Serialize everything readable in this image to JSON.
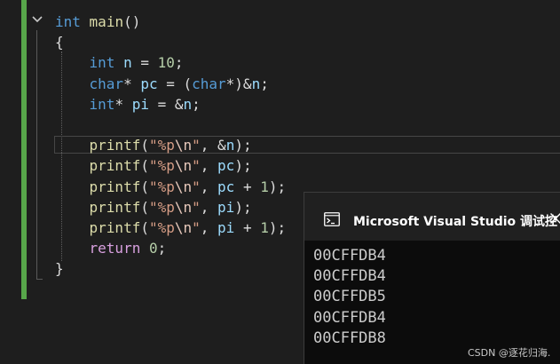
{
  "editor": {
    "lines": [
      [
        {
          "t": "int",
          "c": "kw"
        },
        {
          "t": " ",
          "c": "p"
        },
        {
          "t": "main",
          "c": "fn"
        },
        {
          "t": "()",
          "c": "p"
        }
      ],
      [
        {
          "t": "{",
          "c": "p"
        }
      ],
      [
        {
          "t": "    ",
          "c": "p"
        },
        {
          "t": "int",
          "c": "kw"
        },
        {
          "t": " ",
          "c": "p"
        },
        {
          "t": "n",
          "c": "id"
        },
        {
          "t": " = ",
          "c": "p"
        },
        {
          "t": "10",
          "c": "num"
        },
        {
          "t": ";",
          "c": "p"
        }
      ],
      [
        {
          "t": "    ",
          "c": "p"
        },
        {
          "t": "char",
          "c": "kw"
        },
        {
          "t": "* ",
          "c": "p"
        },
        {
          "t": "pc",
          "c": "id"
        },
        {
          "t": " = (",
          "c": "p"
        },
        {
          "t": "char",
          "c": "kw"
        },
        {
          "t": "*)&",
          "c": "p"
        },
        {
          "t": "n",
          "c": "id"
        },
        {
          "t": ";",
          "c": "p"
        }
      ],
      [
        {
          "t": "    ",
          "c": "p"
        },
        {
          "t": "int",
          "c": "kw"
        },
        {
          "t": "* ",
          "c": "p"
        },
        {
          "t": "pi",
          "c": "id"
        },
        {
          "t": " = &",
          "c": "p"
        },
        {
          "t": "n",
          "c": "id"
        },
        {
          "t": ";",
          "c": "p"
        }
      ],
      [
        {
          "t": "",
          "c": "p"
        }
      ],
      [
        {
          "t": "    ",
          "c": "p"
        },
        {
          "t": "printf",
          "c": "fn"
        },
        {
          "t": "(",
          "c": "p"
        },
        {
          "t": "\"%p",
          "c": "str"
        },
        {
          "t": "\\n",
          "c": "esc"
        },
        {
          "t": "\"",
          "c": "str"
        },
        {
          "t": ", &",
          "c": "p"
        },
        {
          "t": "n",
          "c": "id"
        },
        {
          "t": ");",
          "c": "p"
        }
      ],
      [
        {
          "t": "    ",
          "c": "p"
        },
        {
          "t": "printf",
          "c": "fn"
        },
        {
          "t": "(",
          "c": "p"
        },
        {
          "t": "\"%p",
          "c": "str"
        },
        {
          "t": "\\n",
          "c": "esc"
        },
        {
          "t": "\"",
          "c": "str"
        },
        {
          "t": ", ",
          "c": "p"
        },
        {
          "t": "pc",
          "c": "id"
        },
        {
          "t": ");",
          "c": "p"
        }
      ],
      [
        {
          "t": "    ",
          "c": "p"
        },
        {
          "t": "printf",
          "c": "fn"
        },
        {
          "t": "(",
          "c": "p"
        },
        {
          "t": "\"%p",
          "c": "str"
        },
        {
          "t": "\\n",
          "c": "esc"
        },
        {
          "t": "\"",
          "c": "str"
        },
        {
          "t": ", ",
          "c": "p"
        },
        {
          "t": "pc",
          "c": "id"
        },
        {
          "t": " + ",
          "c": "p"
        },
        {
          "t": "1",
          "c": "num"
        },
        {
          "t": ");",
          "c": "p"
        }
      ],
      [
        {
          "t": "    ",
          "c": "p"
        },
        {
          "t": "printf",
          "c": "fn"
        },
        {
          "t": "(",
          "c": "p"
        },
        {
          "t": "\"%p",
          "c": "str"
        },
        {
          "t": "\\n",
          "c": "esc"
        },
        {
          "t": "\"",
          "c": "str"
        },
        {
          "t": ", ",
          "c": "p"
        },
        {
          "t": "pi",
          "c": "id"
        },
        {
          "t": ");",
          "c": "p"
        }
      ],
      [
        {
          "t": "    ",
          "c": "p"
        },
        {
          "t": "printf",
          "c": "fn"
        },
        {
          "t": "(",
          "c": "p"
        },
        {
          "t": "\"%p",
          "c": "str"
        },
        {
          "t": "\\n",
          "c": "esc"
        },
        {
          "t": "\"",
          "c": "str"
        },
        {
          "t": ", ",
          "c": "p"
        },
        {
          "t": "pi",
          "c": "id"
        },
        {
          "t": " + ",
          "c": "p"
        },
        {
          "t": "1",
          "c": "num"
        },
        {
          "t": ");",
          "c": "p"
        }
      ],
      [
        {
          "t": "    ",
          "c": "p"
        },
        {
          "t": "return",
          "c": "ctl"
        },
        {
          "t": " ",
          "c": "p"
        },
        {
          "t": "0",
          "c": "num"
        },
        {
          "t": ";",
          "c": "p"
        }
      ],
      [
        {
          "t": "}",
          "c": "p"
        }
      ]
    ],
    "icons": {
      "fold": "chevron-down-icon"
    }
  },
  "console": {
    "title": "Microsoft Visual Studio 调试控",
    "output": [
      "00CFFDB4",
      "00CFFDB4",
      "00CFFDB5",
      "00CFFDB4",
      "00CFFDB8"
    ],
    "icons": {
      "app": "console-app-icon",
      "close": "close-icon"
    }
  },
  "watermark": "CSDN @逐花归海.",
  "colors": {
    "editor_bg": "#1e1e1e",
    "change_bar": "#57a64a",
    "keyword": "#569cd6",
    "control_keyword": "#d8a0df",
    "function": "#dcdcaa",
    "identifier": "#9cdcfe",
    "string": "#d69d85",
    "number": "#b5cea8",
    "console_bg": "#0c0c0c",
    "console_titlebar": "#202020"
  }
}
